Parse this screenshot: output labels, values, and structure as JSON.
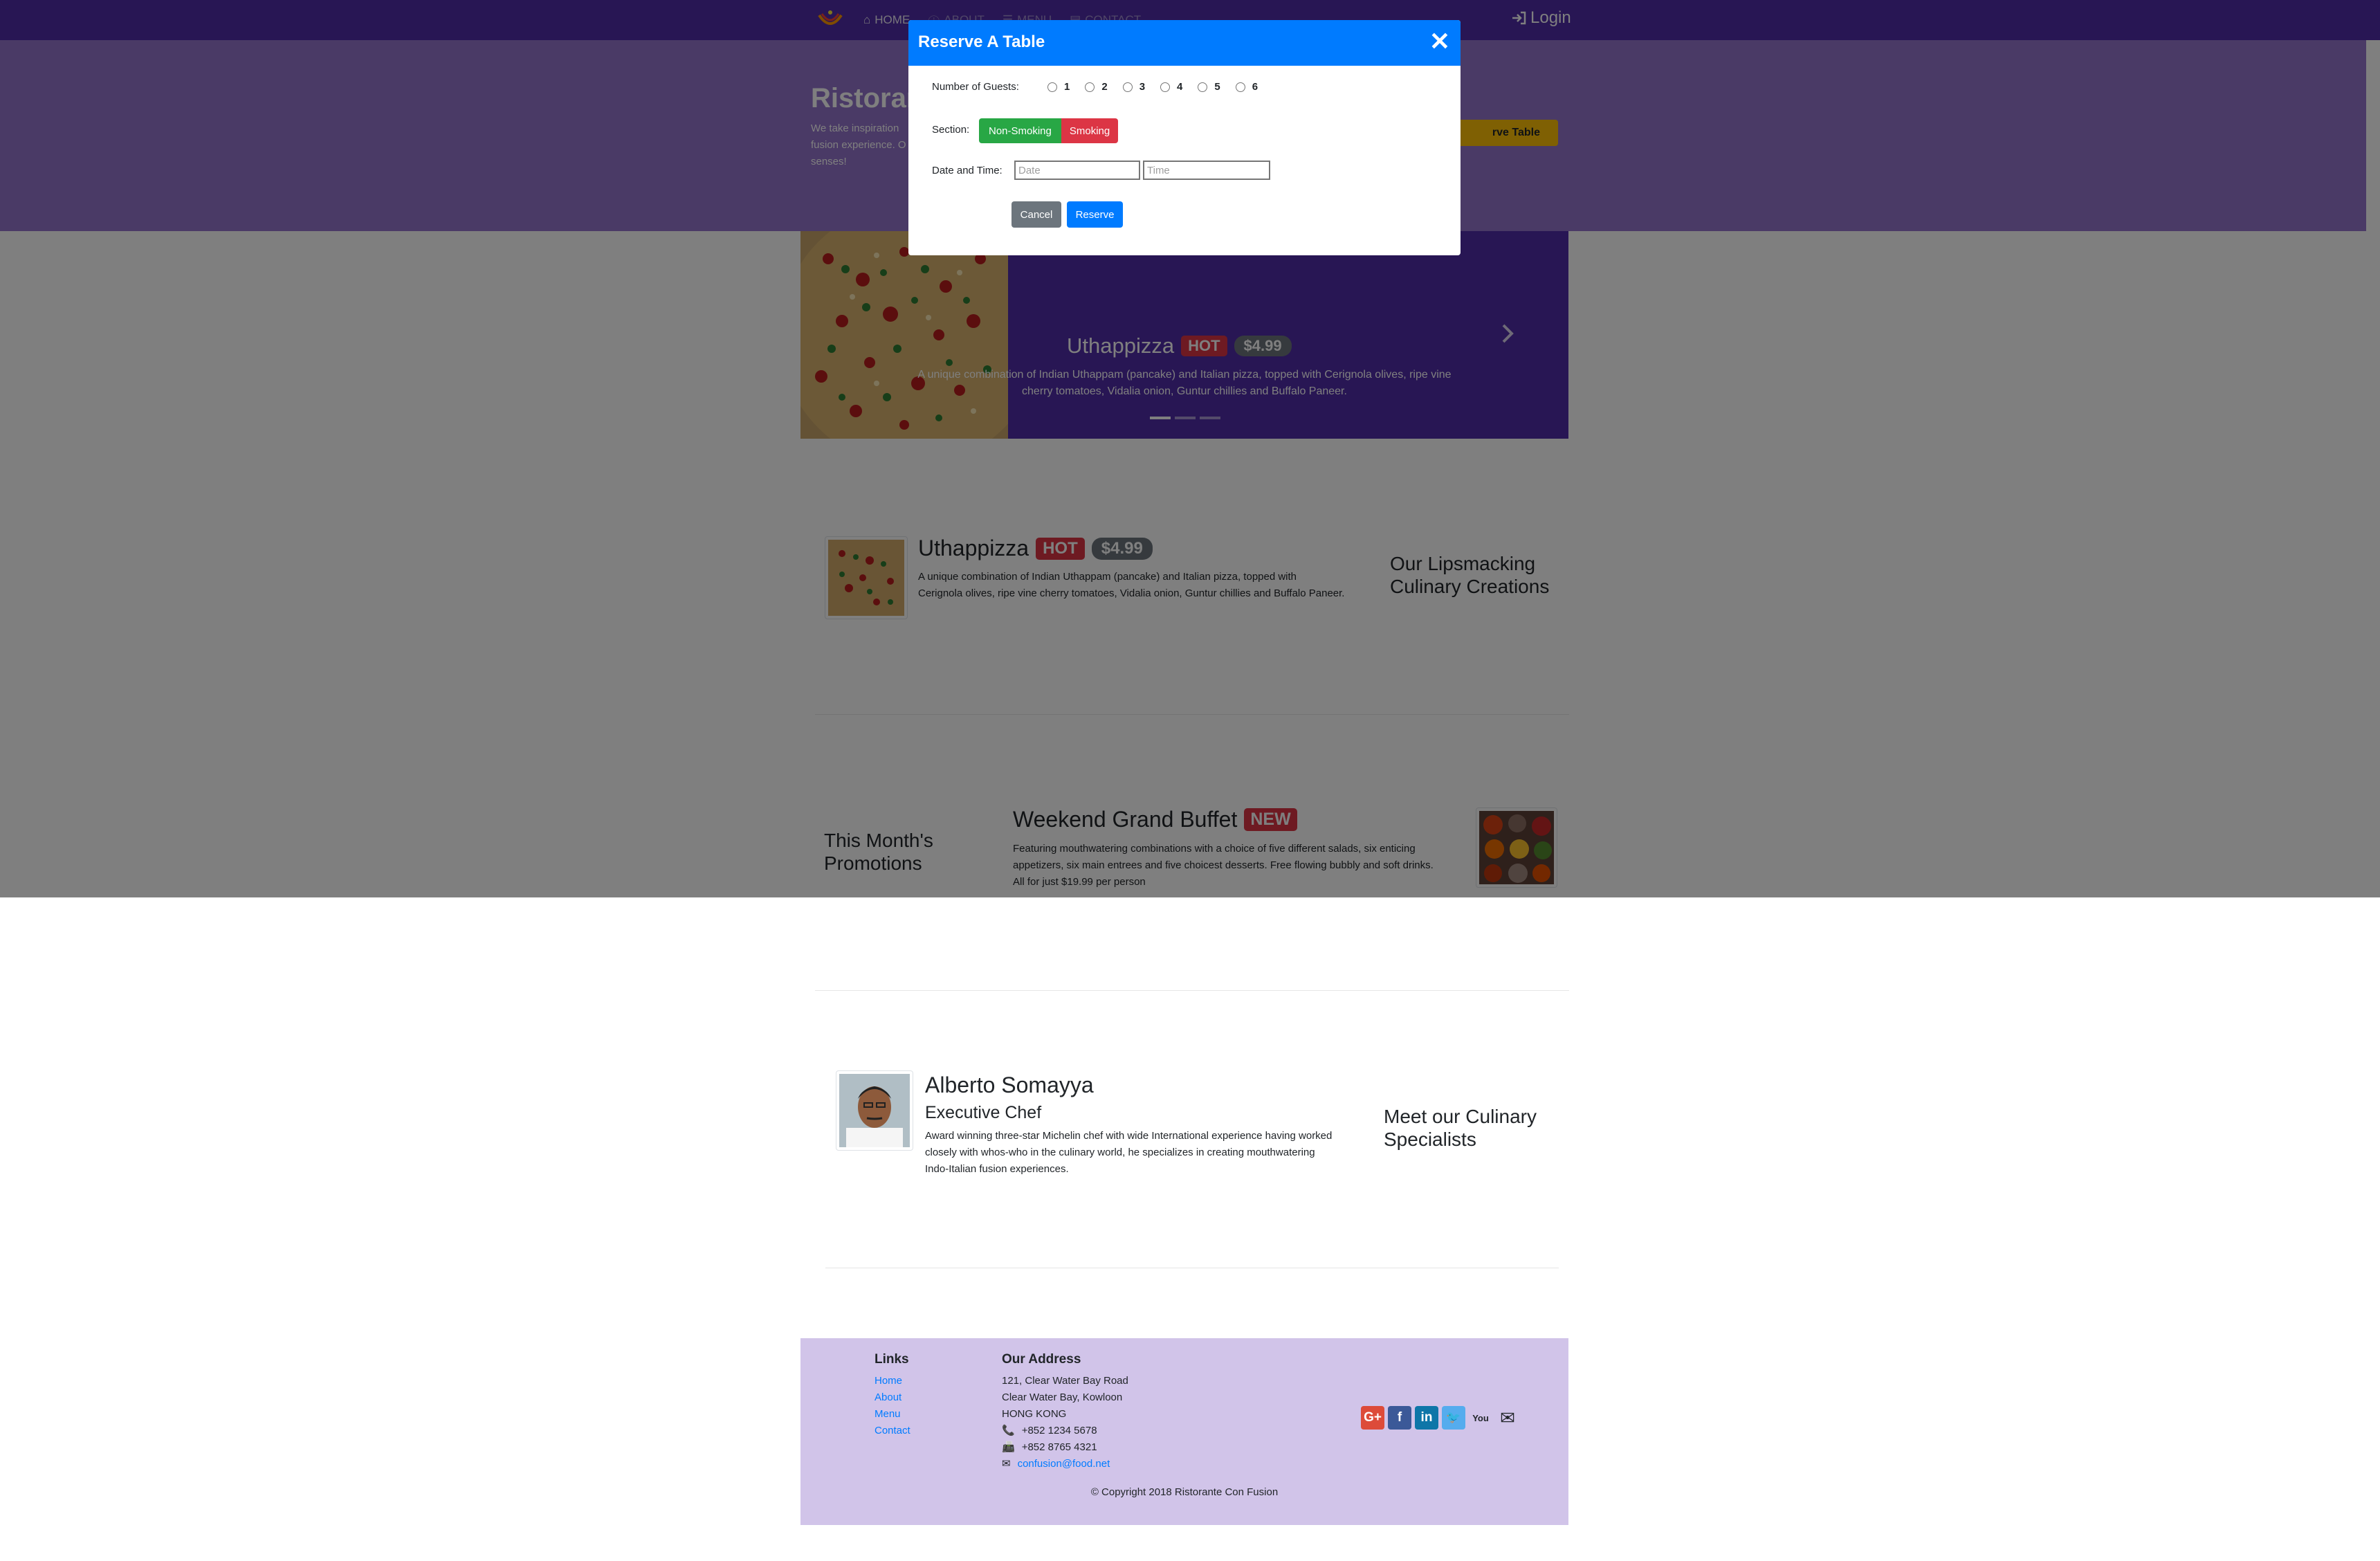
{
  "navbar": {
    "items": [
      {
        "label": "HOME",
        "icon": "home-icon"
      },
      {
        "label": "ABOUT",
        "icon": "info-icon"
      },
      {
        "label": "MENU",
        "icon": "list-icon"
      },
      {
        "label": "CONTACT",
        "icon": "address-card-icon"
      }
    ],
    "login_label": "Login",
    "colors": {
      "primary": "#512da8",
      "jumbotron": "#9575cd"
    }
  },
  "jumbotron": {
    "title": "Ristorante",
    "text_lines": [
      "We take inspiration",
      "fusion experience. O",
      "senses!"
    ],
    "reserve_label": "rve Table"
  },
  "carousel": {
    "name": "Uthappizza",
    "label": "HOT",
    "price": "$4.99",
    "description_line1": "A unique combination of Indian Uthappam (pancake) and Italian pizza, topped with Cerignola olives, ripe vine",
    "description_line2": "cherry tomatoes, Vidalia onion, Guntur chillies and Buffalo Paneer.",
    "indicator_count": 3,
    "active_indicator": 1
  },
  "dish": {
    "name": "Uthappizza",
    "label": "HOT",
    "price": "$4.99",
    "description_line1": "A unique combination of Indian Uthappam (pancake) and Italian pizza, topped with",
    "description_line2": "Cerignola olives, ripe vine cherry tomatoes, Vidalia onion, Guntur chillies and Buffalo Paneer.",
    "side_heading_line1": "Our Lipsmacking",
    "side_heading_line2": "Culinary Creations"
  },
  "promotion": {
    "side_heading_line1": "This Month's",
    "side_heading_line2": "Promotions",
    "name": "Weekend Grand Buffet",
    "label": "NEW",
    "description_line1": "Featuring mouthwatering combinations with a choice of five different salads, six enticing",
    "description_line2": "appetizers, six main entrees and five choicest desserts. Free flowing bubbly and soft drinks.",
    "description_line3": "All for just $19.99 per person"
  },
  "leader": {
    "name": "Alberto Somayya",
    "designation": "Executive Chef",
    "description_line1": "Award winning three-star Michelin chef with wide International experience having worked",
    "description_line2": "closely with whos-who in the culinary world, he specializes in creating mouthwatering",
    "description_line3": "Indo-Italian fusion experiences.",
    "side_heading_line1": "Meet our Culinary",
    "side_heading_line2": "Specialists"
  },
  "footer": {
    "links_heading": "Links",
    "links": [
      "Home",
      "About",
      "Menu",
      "Contact"
    ],
    "address_heading": "Our Address",
    "address_line1": "121, Clear Water Bay Road",
    "address_line2": "Clear Water Bay, Kowloon",
    "address_line3": "HONG KONG",
    "phone": "+852 1234 5678",
    "fax": "+852 8765 4321",
    "email": "confusion@food.net",
    "social": [
      {
        "icon": "google-plus-icon",
        "color": "#dd4b39",
        "glyph": "G+"
      },
      {
        "icon": "facebook-icon",
        "color": "#3b5998",
        "glyph": "f"
      },
      {
        "icon": "linkedin-icon",
        "color": "#0e76a8",
        "glyph": "in"
      },
      {
        "icon": "twitter-icon",
        "color": "#55acee",
        "glyph": "🐦"
      },
      {
        "icon": "youtube-icon",
        "color": "#212529",
        "glyph": "You"
      },
      {
        "icon": "mail-icon",
        "color": "#212529",
        "glyph": "✉"
      }
    ],
    "copyright": "© Copyright 2018 Ristorante Con Fusion"
  },
  "modal": {
    "title": "Reserve A Table",
    "close_glyph": "✕",
    "guests_label": "Number of Guests:",
    "guest_options": [
      "1",
      "2",
      "3",
      "4",
      "5",
      "6"
    ],
    "section_label": "Section:",
    "section_options": [
      "Non-Smoking",
      "Smoking"
    ],
    "datetime_label": "Date and Time:",
    "date_placeholder": "Date",
    "time_placeholder": "Time",
    "cancel_label": "Cancel",
    "reserve_label": "Reserve",
    "colors": {
      "header": "#007bff",
      "non_smoking": "#28a745",
      "smoking": "#dc3545",
      "cancel": "#6c757d"
    }
  }
}
